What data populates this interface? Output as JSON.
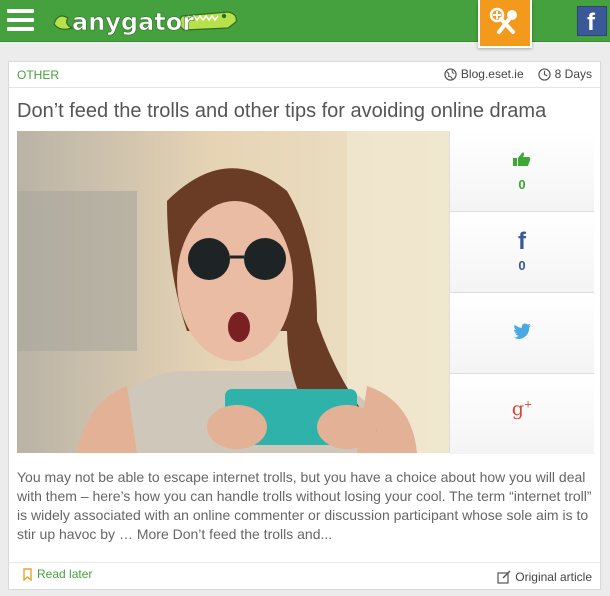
{
  "header": {
    "logo_text": "anygator",
    "colors": {
      "bar": "#45a13d",
      "accent": "#f39a1c",
      "facebook": "#3b5998"
    }
  },
  "article": {
    "category": "OTHER",
    "source": "Blog.eset.ie",
    "age": "8 Days",
    "title": "Don’t feed the trolls and other tips for avoiding online drama",
    "excerpt": "You may not be able to escape internet trolls, but you have a choice about how you will deal with them – here’s how you can handle trolls without losing your cool. The term “internet troll” is widely associated with an online commenter or discussion participant whose sole aim is to stir up havoc by … More Don’t feed the trolls and...",
    "read_later_label": "Read later",
    "original_label": "Original article"
  },
  "share": {
    "like_count": "0",
    "facebook_count": "0",
    "icons": [
      "thumbs-up-icon",
      "facebook-icon",
      "twitter-icon",
      "google-plus-icon"
    ]
  }
}
